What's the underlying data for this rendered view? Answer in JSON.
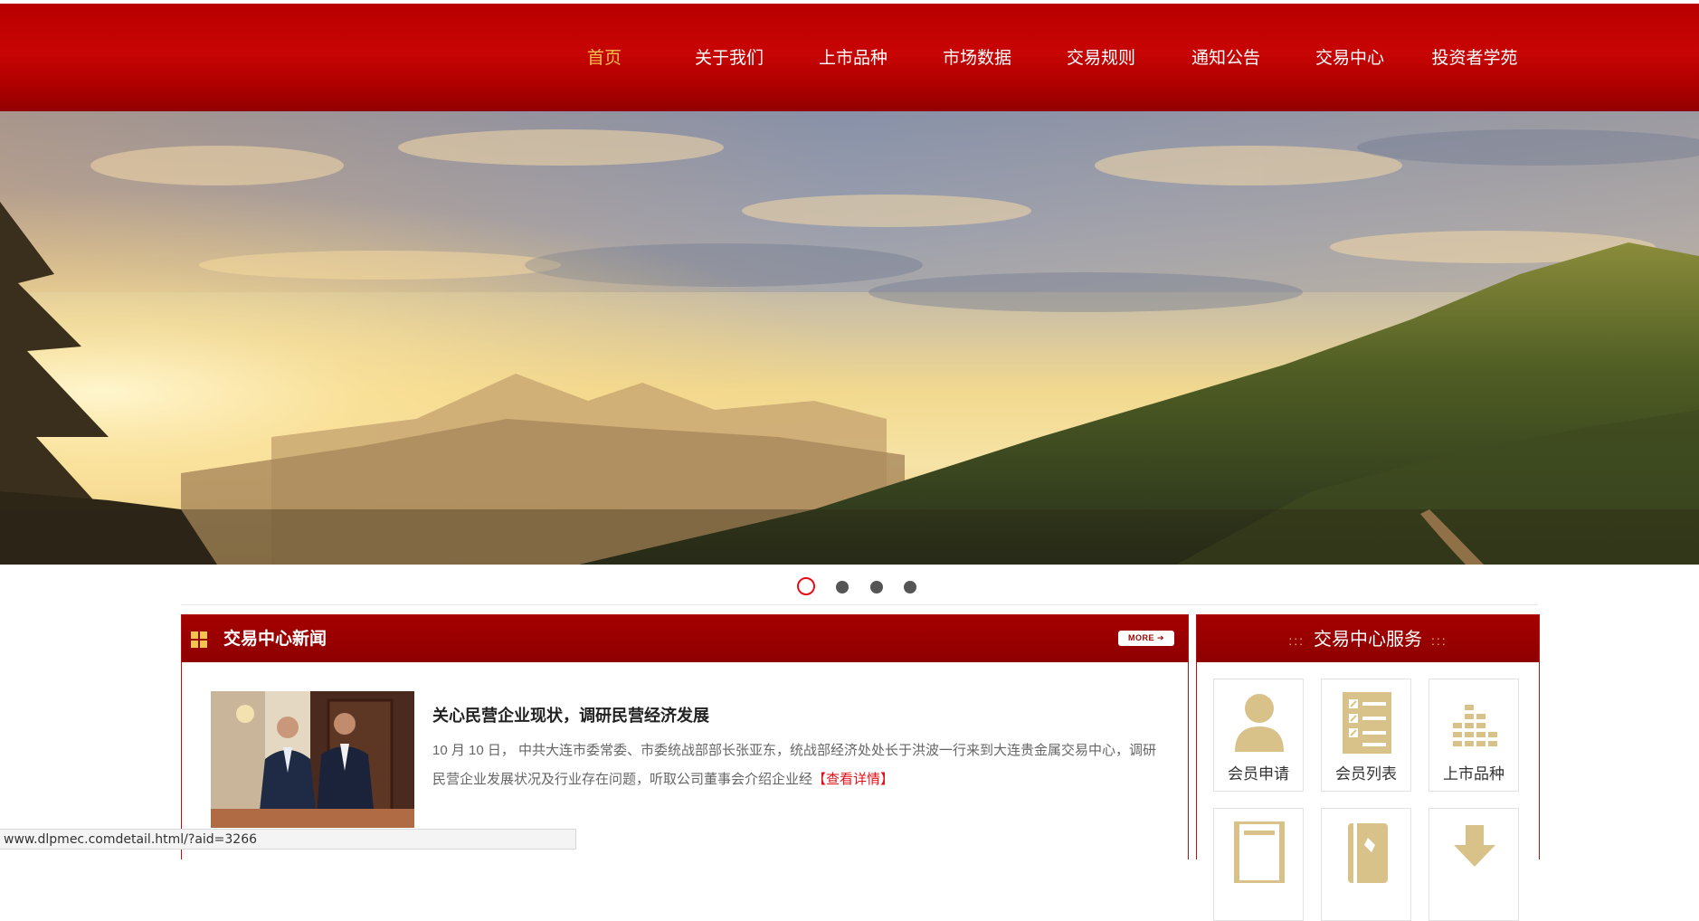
{
  "nav": {
    "items": [
      {
        "label": "首页",
        "active": true
      },
      {
        "label": "关于我们"
      },
      {
        "label": "上市品种"
      },
      {
        "label": "市场数据"
      },
      {
        "label": "交易规则"
      },
      {
        "label": "通知公告"
      },
      {
        "label": "交易中心"
      },
      {
        "label": "投资者学苑"
      }
    ]
  },
  "carousel": {
    "slide_count": 4,
    "active_index": 0
  },
  "news": {
    "title": "交易中心新闻",
    "more_label": "MORE",
    "headline": "关心民营企业现状，调研民营经济发展",
    "summary": "10 月 10 日， 中共大连市委常委、市委统战部部长张亚东，统战部经济处处长于洪波一行来到大连贵金属交易中心，调研民营企业发展状况及行业存在问题，听取公司董事会介绍企业经",
    "read_more": "【查看详情】"
  },
  "services": {
    "title": "交易中心服务",
    "decoration": ":::",
    "items": [
      {
        "label": "会员申请",
        "icon": "user-icon"
      },
      {
        "label": "会员列表",
        "icon": "list-icon"
      },
      {
        "label": "上市品种",
        "icon": "bar-chart-icon"
      },
      {
        "label": "",
        "icon": "document-icon"
      },
      {
        "label": "",
        "icon": "book-icon"
      },
      {
        "label": "",
        "icon": "download-icon"
      }
    ]
  },
  "status_bar": {
    "url": "www.dlpmec.comdetail.html/?aid=3266"
  },
  "colors": {
    "brand_red": "#b80000",
    "nav_active": "#f4c14e",
    "gold_icon": "#d8c28a",
    "accent_red": "#e3101a"
  }
}
